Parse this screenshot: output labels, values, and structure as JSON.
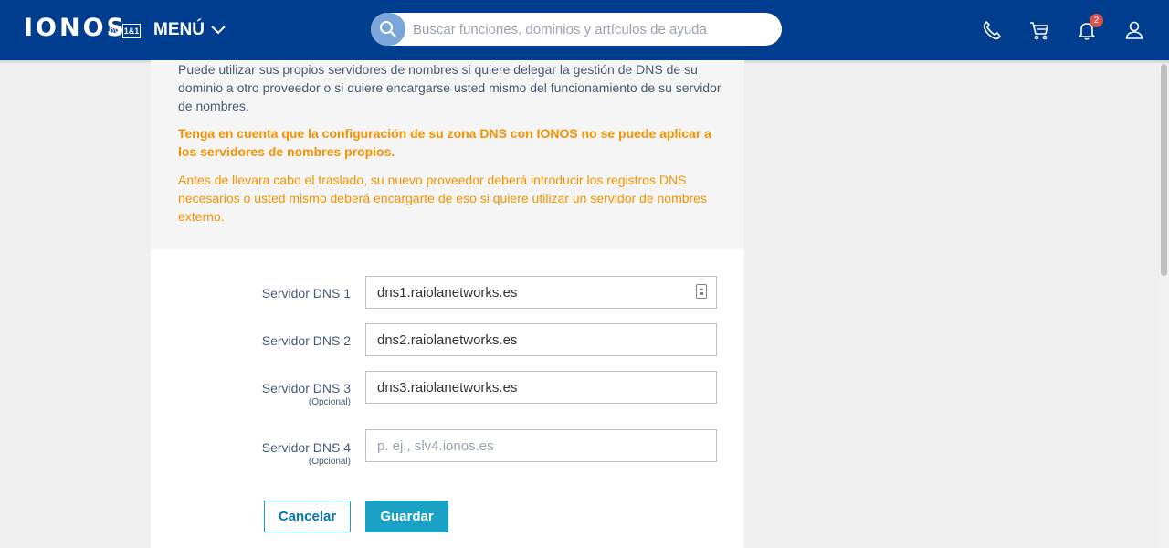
{
  "header": {
    "logo": "IONOS",
    "logo_by": "by",
    "logo_brand": "1&1",
    "menu_label": "MENÚ",
    "search_placeholder": "Buscar funciones, dominios y artículos de ayuda",
    "notifications_count": "2",
    "icons": [
      "phone-icon",
      "cart-icon",
      "bell-icon",
      "user-icon"
    ],
    "brand_color": "#003d8f"
  },
  "info": {
    "paragraph1": "Puede utilizar sus propios servidores de nombres si quiere delegar la gestión de DNS de su dominio a otro proveedor o si quiere encargarse usted mismo del funcionamiento de su servidor de nombres.",
    "warning": "Tenga en cuenta que la configuración de su zona DNS con IONOS no se puede aplicar a los servidores de nombres propios.",
    "note": "Antes de llevara cabo el traslado, su nuevo proveedor deberá introducir los registros DNS necesarios o usted mismo deberá encargarte de eso si quiere utilizar un servidor de nombres externo.",
    "warning_color": "#f39200"
  },
  "form": {
    "dns1": {
      "label": "Servidor DNS 1",
      "value": "dns1.raiolanetworks.es"
    },
    "dns2": {
      "label": "Servidor DNS 2",
      "value": "dns2.raiolanetworks.es"
    },
    "dns3": {
      "label": "Servidor DNS 3",
      "sublabel": "(Opcional)",
      "value": "dns3.raiolanetworks.es"
    },
    "dns4": {
      "label": "Servidor DNS 4",
      "sublabel": "(Opcional)",
      "value": "",
      "placeholder": "p. ej., slv4.ionos.es"
    }
  },
  "actions": {
    "cancel_label": "Cancelar",
    "save_label": "Guardar",
    "accent_color": "#1aa1c6"
  }
}
